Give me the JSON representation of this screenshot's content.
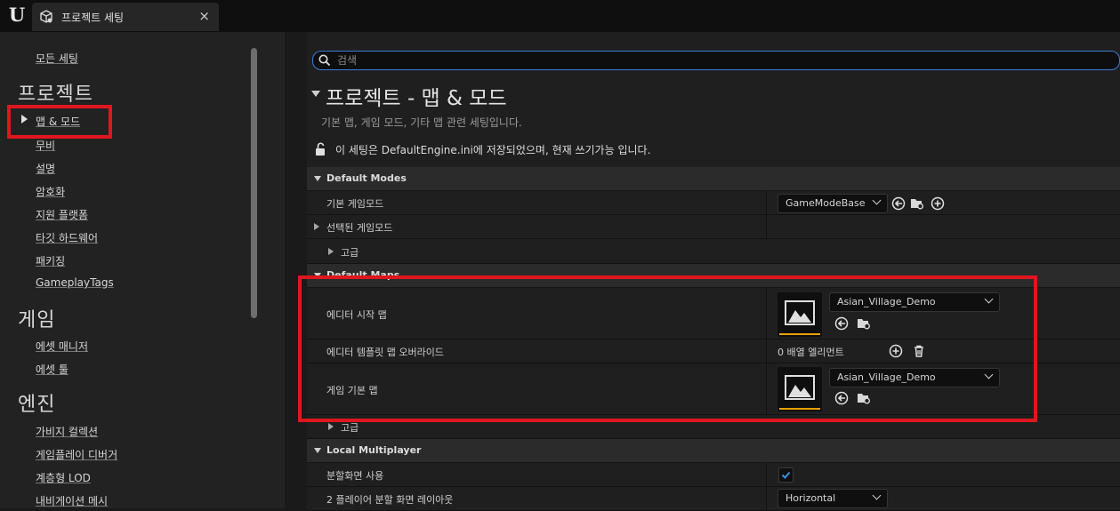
{
  "topbar": {
    "logo": "U",
    "tab_title": "프로젝트 세팅",
    "close_glyph": "×"
  },
  "sidebar": {
    "all_settings": "모든 세팅",
    "cat_project": "프로젝트",
    "project_items": [
      "맵 & 모드",
      "무비",
      "설명",
      "암호화",
      "지원 플랫폼",
      "타깃 하드웨어",
      "패키징",
      "GameplayTags"
    ],
    "cat_game": "게임",
    "game_items": [
      "에셋 매니저",
      "에셋 툴"
    ],
    "cat_engine": "엔진",
    "engine_items": [
      "가비지 컬렉션",
      "게임플레이 디버거",
      "계층형 LOD",
      "내비게이션 메시"
    ]
  },
  "search": {
    "placeholder": "검색"
  },
  "page": {
    "title": "프로젝트 - 맵 & 모드",
    "desc": "기본 맵, 게임 모드, 기타 맵 관련 세팅입니다.",
    "lock_text": "이 세팅은 DefaultEngine.ini에 저장되었으며, 현재 쓰기가능 입니다."
  },
  "default_modes": {
    "header": "Default Modes",
    "default_gamemode_label": "기본 게임모드",
    "default_gamemode_value": "GameModeBase",
    "selected_gamemode_label": "선택된 게임모드",
    "advanced_label": "고급"
  },
  "default_maps": {
    "header": "Default Maps",
    "editor_startup_label": "에디터 시작 맵",
    "editor_startup_value": "Asian_Village_Demo",
    "template_override_label": "에디터 템플릿 맵 오버라이드",
    "template_override_value": "0 배열 엘리먼트",
    "game_default_label": "게임 기본 맵",
    "game_default_value": "Asian_Village_Demo",
    "advanced_label": "고급"
  },
  "local_multiplayer": {
    "header": "Local Multiplayer",
    "splitscreen_label": "분할화면 사용",
    "splitscreen_checked": true,
    "two_player_label": "2 플레이어 분할 화면 레이아웃",
    "two_player_value": "Horizontal"
  },
  "colors": {
    "highlight": "#e0161f",
    "accent": "#3a7bd5",
    "thumb_bar": "#e8a000"
  }
}
